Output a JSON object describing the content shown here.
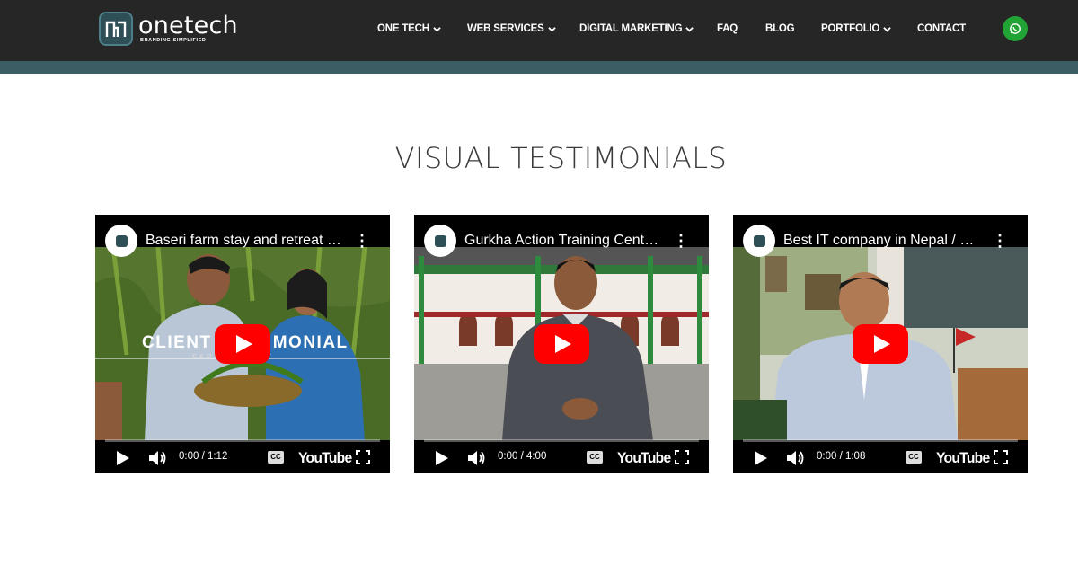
{
  "brand": {
    "name_prefix": "one",
    "name_suffix": "tech",
    "tagline": "BRANDING SIMPLIFIED"
  },
  "nav": {
    "items": [
      {
        "label": "ONE TECH",
        "dropdown": true
      },
      {
        "label": "WEB SERVICES",
        "dropdown": true
      },
      {
        "label": "DIGITAL MARKETING",
        "dropdown": true
      },
      {
        "label": "FAQ",
        "dropdown": false
      },
      {
        "label": "BLOG",
        "dropdown": false
      },
      {
        "label": "PORTFOLIO",
        "dropdown": true
      },
      {
        "label": "CONTACT",
        "dropdown": false
      }
    ],
    "whatsapp_icon": "whatsapp-icon"
  },
  "section": {
    "heading": "VISUAL TESTIMONIALS"
  },
  "videos": [
    {
      "title": "Baseri farm stay and retreat Nepal Visual Testimonial",
      "time": "0:00 / 1:12",
      "overlay": "CLIENT TESTIMONIAL",
      "overlay_sub": "FARM RESORT"
    },
    {
      "title": "Gurkha Action Training Center Visual Testimonial",
      "time": "0:00 / 4:00"
    },
    {
      "title": "Best IT company in Nepal / Visual Testimonial",
      "time": "0:00 / 1:08"
    }
  ],
  "player": {
    "cc_label": "CC",
    "platform_label": "YouTube"
  },
  "colors": {
    "header_bg": "#262626",
    "accent_teal": "#3b5d63",
    "play_red": "#ff0000",
    "whatsapp_green": "#21a336"
  }
}
